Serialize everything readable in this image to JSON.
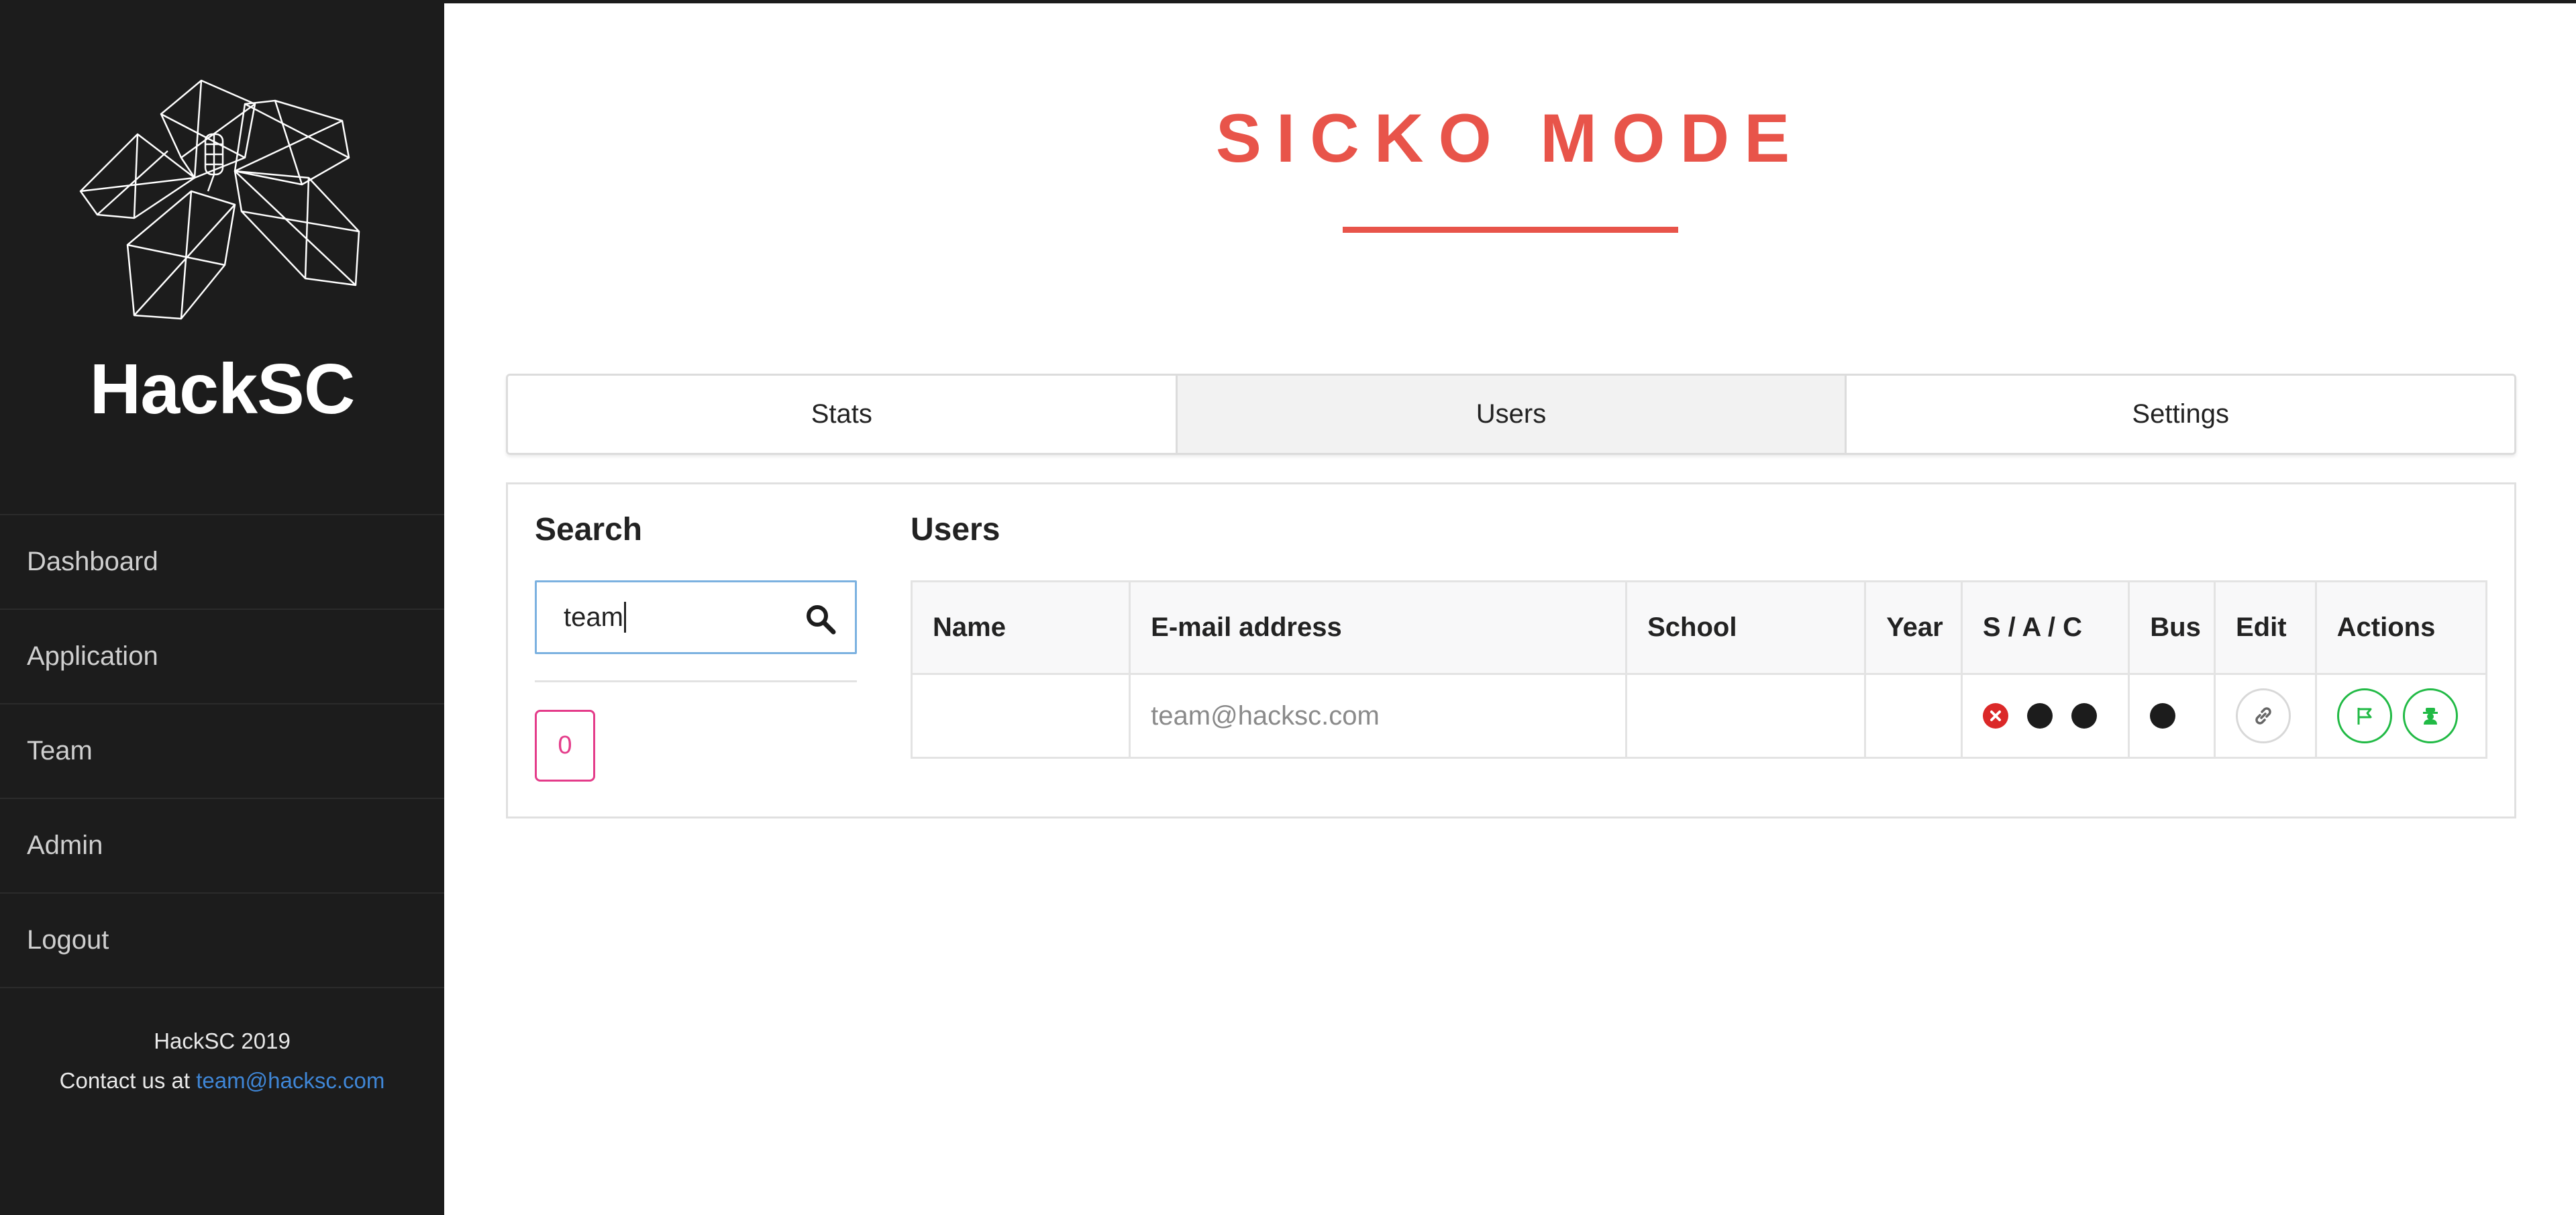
{
  "sidebar": {
    "brand": "HackSC",
    "nav": [
      {
        "label": "Dashboard"
      },
      {
        "label": "Application"
      },
      {
        "label": "Team"
      },
      {
        "label": "Admin"
      },
      {
        "label": "Logout"
      }
    ],
    "footer": {
      "year_line": "HackSC 2019",
      "contact_prefix": "Contact us at ",
      "contact_email": "team@hacksc.com"
    }
  },
  "main": {
    "title": "SICKO MODE",
    "tabs": [
      {
        "label": "Stats",
        "active": false
      },
      {
        "label": "Users",
        "active": true
      },
      {
        "label": "Settings",
        "active": false
      }
    ],
    "search": {
      "heading": "Search",
      "value": "team",
      "result_count": "0"
    },
    "users": {
      "heading": "Users",
      "columns": [
        "Name",
        "E-mail address",
        "School",
        "Year",
        "S / A / C",
        "Bus",
        "Edit",
        "Actions"
      ],
      "rows": [
        {
          "name": "",
          "email": "team@hacksc.com",
          "school": "",
          "year": ""
        }
      ]
    }
  },
  "colors": {
    "accent": "#e8544a",
    "sidebar_bg": "#1c1c1c",
    "link": "#3f86d6",
    "badge": "#e43c8a",
    "success": "#21ba45",
    "error": "#db2828"
  }
}
